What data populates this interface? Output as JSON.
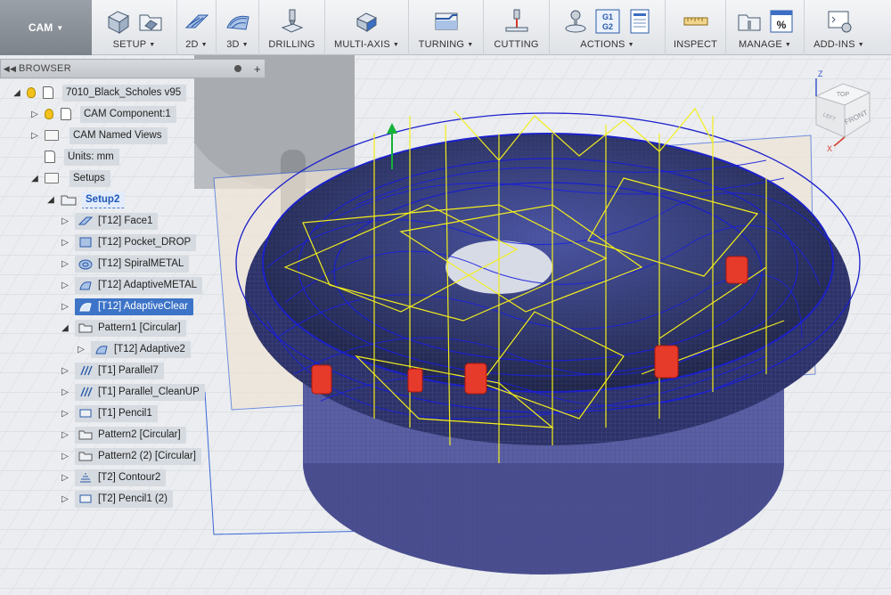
{
  "workspace": {
    "label": "CAM"
  },
  "toolbar": {
    "groups": [
      {
        "label": "SETUP",
        "dropdown": true
      },
      {
        "label": "2D",
        "dropdown": true
      },
      {
        "label": "3D",
        "dropdown": true
      },
      {
        "label": "DRILLING",
        "dropdown": false
      },
      {
        "label": "MULTI-AXIS",
        "dropdown": true
      },
      {
        "label": "TURNING",
        "dropdown": true
      },
      {
        "label": "CUTTING",
        "dropdown": false
      },
      {
        "label": "ACTIONS",
        "dropdown": true
      },
      {
        "label": "INSPECT",
        "dropdown": false
      },
      {
        "label": "MANAGE",
        "dropdown": true
      },
      {
        "label": "ADD-INS",
        "dropdown": true
      }
    ],
    "icons": {
      "setup": [
        "setup-icon",
        "folder-setup-icon"
      ],
      "2d": [
        "2d-toolpath-icon"
      ],
      "3d": [
        "3d-toolpath-icon"
      ],
      "drilling": [
        "drill-icon"
      ],
      "multiaxis": [
        "multi-axis-icon"
      ],
      "turning": [
        "turning-icon"
      ],
      "cutting": [
        "cutting-icon"
      ],
      "actions": [
        "simulate-icon",
        "post-process-icon",
        "setup-sheet-icon"
      ],
      "actions_code": {
        "line1": "G1",
        "line2": "G2"
      },
      "inspect": [
        "measure-icon"
      ],
      "manage": [
        "tool-library-icon",
        "templates-icon"
      ],
      "manage_badge": "%",
      "addins": [
        "scripts-icon"
      ]
    },
    "colors": {
      "accent": "#2e6fd0"
    }
  },
  "browser": {
    "title": "BROWSER",
    "tree": [
      {
        "label": "7010_Black_Scholes v95",
        "kind": "root"
      },
      {
        "label": "CAM Component:1",
        "kind": "component"
      },
      {
        "label": "CAM Named Views",
        "kind": "folder"
      },
      {
        "label": "Units: mm",
        "kind": "units"
      },
      {
        "label": "Setups",
        "kind": "setups"
      },
      {
        "label": "Setup2",
        "kind": "setup"
      },
      {
        "label": "[T12] Face1",
        "kind": "op"
      },
      {
        "label": "[T12] Pocket_DROP",
        "kind": "op"
      },
      {
        "label": "[T12] SpiralMETAL",
        "kind": "op"
      },
      {
        "label": "[T12] AdaptiveMETAL",
        "kind": "op"
      },
      {
        "label": "[T12] AdaptiveClear",
        "kind": "op",
        "selected": true
      },
      {
        "label": "Pattern1 [Circular]",
        "kind": "pattern"
      },
      {
        "label": "[T12] Adaptive2",
        "kind": "op"
      },
      {
        "label": "[T1] Parallel7",
        "kind": "op"
      },
      {
        "label": "[T1] Parallel_CleanUP",
        "kind": "op"
      },
      {
        "label": "[T1] Pencil1",
        "kind": "op"
      },
      {
        "label": "Pattern2 [Circular]",
        "kind": "pattern"
      },
      {
        "label": "Pattern2 (2) [Circular]",
        "kind": "pattern"
      },
      {
        "label": "[T2] Contour2",
        "kind": "op"
      },
      {
        "label": "[T2] Pencil1 (2)",
        "kind": "op"
      }
    ]
  },
  "viewcube": {
    "top": "TOP",
    "front": "FRONT",
    "left": "LEFT",
    "axis_x": "X",
    "axis_z": "Z"
  }
}
